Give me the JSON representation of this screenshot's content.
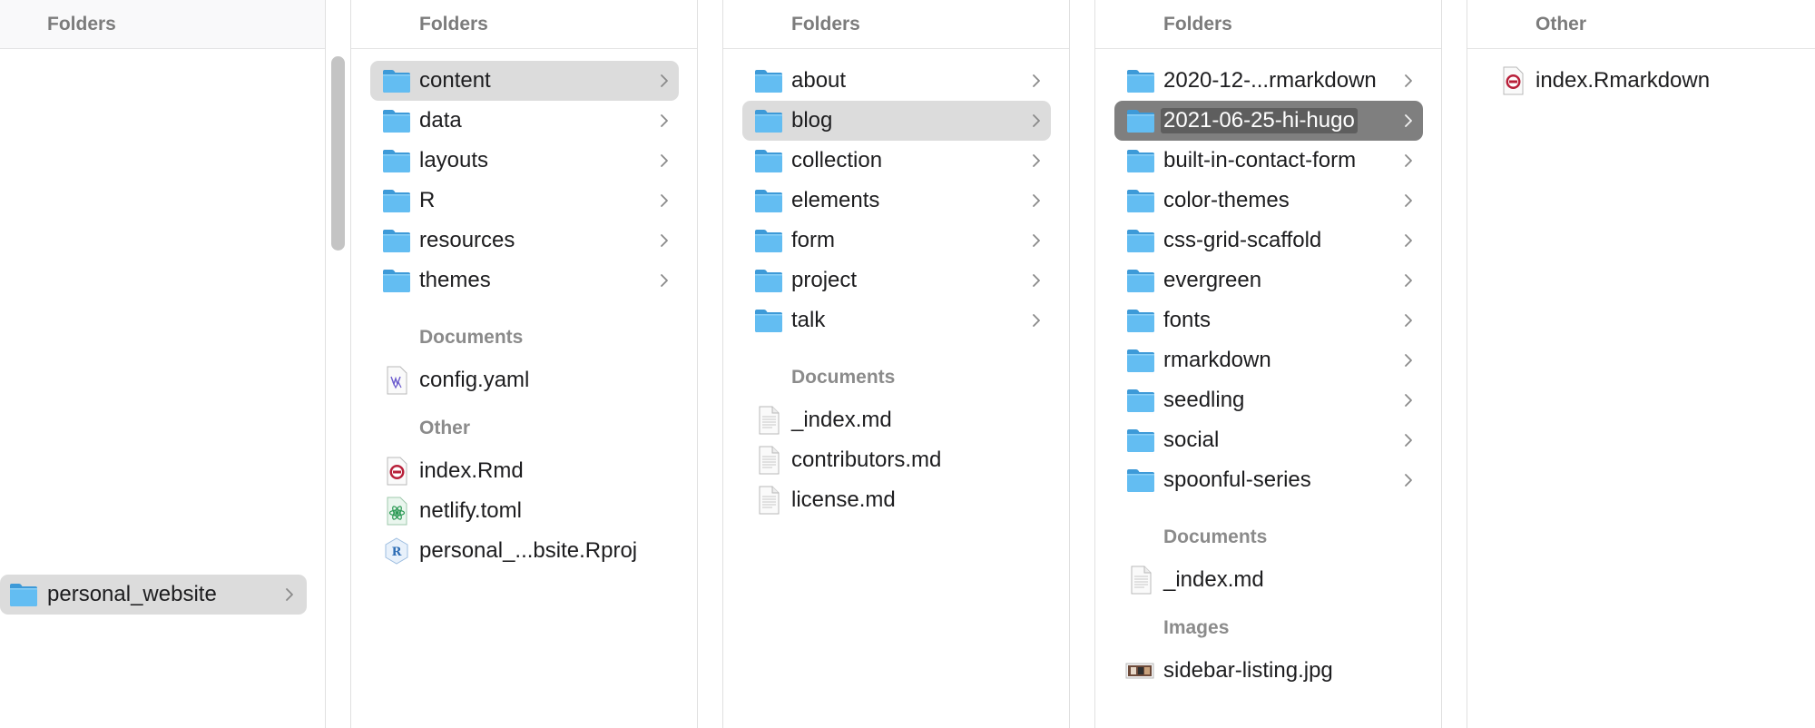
{
  "columns": [
    {
      "header": "Folders",
      "items": [
        {
          "label": "personal_website"
        }
      ]
    },
    {
      "header": "Folders",
      "folders": [
        {
          "label": "content"
        },
        {
          "label": "data"
        },
        {
          "label": "layouts"
        },
        {
          "label": "R"
        },
        {
          "label": "resources"
        },
        {
          "label": "themes"
        }
      ],
      "documents_heading": "Documents",
      "documents": [
        {
          "label": "config.yaml"
        }
      ],
      "other_heading": "Other",
      "other": [
        {
          "label": "index.Rmd"
        },
        {
          "label": "netlify.toml"
        },
        {
          "label": "personal_...bsite.Rproj"
        }
      ]
    },
    {
      "header": "Folders",
      "folders": [
        {
          "label": "about"
        },
        {
          "label": "blog"
        },
        {
          "label": "collection"
        },
        {
          "label": "elements"
        },
        {
          "label": "form"
        },
        {
          "label": "project"
        },
        {
          "label": "talk"
        }
      ],
      "documents_heading": "Documents",
      "documents": [
        {
          "label": "_index.md"
        },
        {
          "label": "contributors.md"
        },
        {
          "label": "license.md"
        }
      ]
    },
    {
      "header": "Folders",
      "folders": [
        {
          "label": "2020-12-...rmarkdown"
        },
        {
          "label": "2021-06-25-hi-hugo"
        },
        {
          "label": "built-in-contact-form"
        },
        {
          "label": "color-themes"
        },
        {
          "label": "css-grid-scaffold"
        },
        {
          "label": "evergreen"
        },
        {
          "label": "fonts"
        },
        {
          "label": "rmarkdown"
        },
        {
          "label": "seedling"
        },
        {
          "label": "social"
        },
        {
          "label": "spoonful-series"
        }
      ],
      "documents_heading": "Documents",
      "documents": [
        {
          "label": "_index.md"
        }
      ],
      "images_heading": "Images",
      "images": [
        {
          "label": "sidebar-listing.jpg"
        }
      ]
    },
    {
      "header": "Other",
      "other": [
        {
          "label": "index.Rmarkdown"
        }
      ]
    }
  ],
  "colors": {
    "folder_blue": "#5fb9f1",
    "selection_inactive": "#dcdcdc",
    "selection_active": "#7f7f7f"
  }
}
